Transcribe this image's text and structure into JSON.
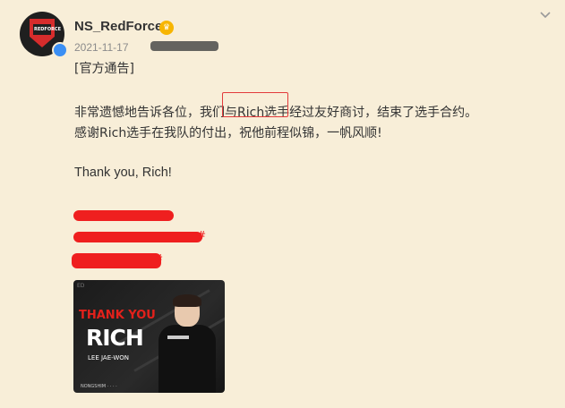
{
  "post": {
    "username": "NS_RedForce",
    "timestamp": "2021-11-17",
    "fan_badge_icon": "crown-badge-icon",
    "verified_icon": "verified-badge-icon",
    "avatar_text": "REDFORCE",
    "menu_icon": "chevron-down-icon",
    "lines": [
      "[官方通告]",
      "非常遗憾地告诉各位，我们与Rich选手经过友好商讨，结束了选手合约。",
      "感谢Rich选手在我队的付出，祝他前程似锦，一帆风顺!",
      "Thank you, Rich!"
    ],
    "hashtags_redacted": [
      "#",
      "#"
    ],
    "image": {
      "title_line1": "THANK YOU",
      "title_line2": "RICH",
      "subtitle": "LEE JAE-WON",
      "corner_text": "ED",
      "footer_text": "NONGSHIM  ·  ·  ·  ·"
    }
  },
  "colors": {
    "background": "#f8eed8",
    "highlight_border": "#e23b3b",
    "redaction": "#ef1f1f",
    "accent_red": "#e3211b"
  }
}
